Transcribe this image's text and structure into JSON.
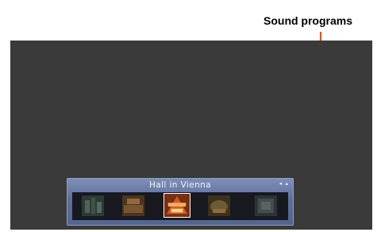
{
  "callout": {
    "label": "Sound programs"
  },
  "osd": {
    "title": "Hall in Vienna",
    "arrows": "◂ ▴",
    "programs": [
      {
        "icon": "program-thumb-1-icon",
        "selected": false,
        "color": "#3a4a44"
      },
      {
        "icon": "program-thumb-2-icon",
        "selected": false,
        "color": "#6b4c2a"
      },
      {
        "icon": "program-thumb-3-icon",
        "selected": true,
        "color": "#c0501e"
      },
      {
        "icon": "program-thumb-4-icon",
        "selected": false,
        "color": "#5a4a2c"
      },
      {
        "icon": "program-thumb-5-icon",
        "selected": false,
        "color": "#3e4446"
      }
    ]
  },
  "colors": {
    "accent": "#e0571b",
    "screen": "#3a3a3a",
    "osd": "#5c6f9c"
  }
}
